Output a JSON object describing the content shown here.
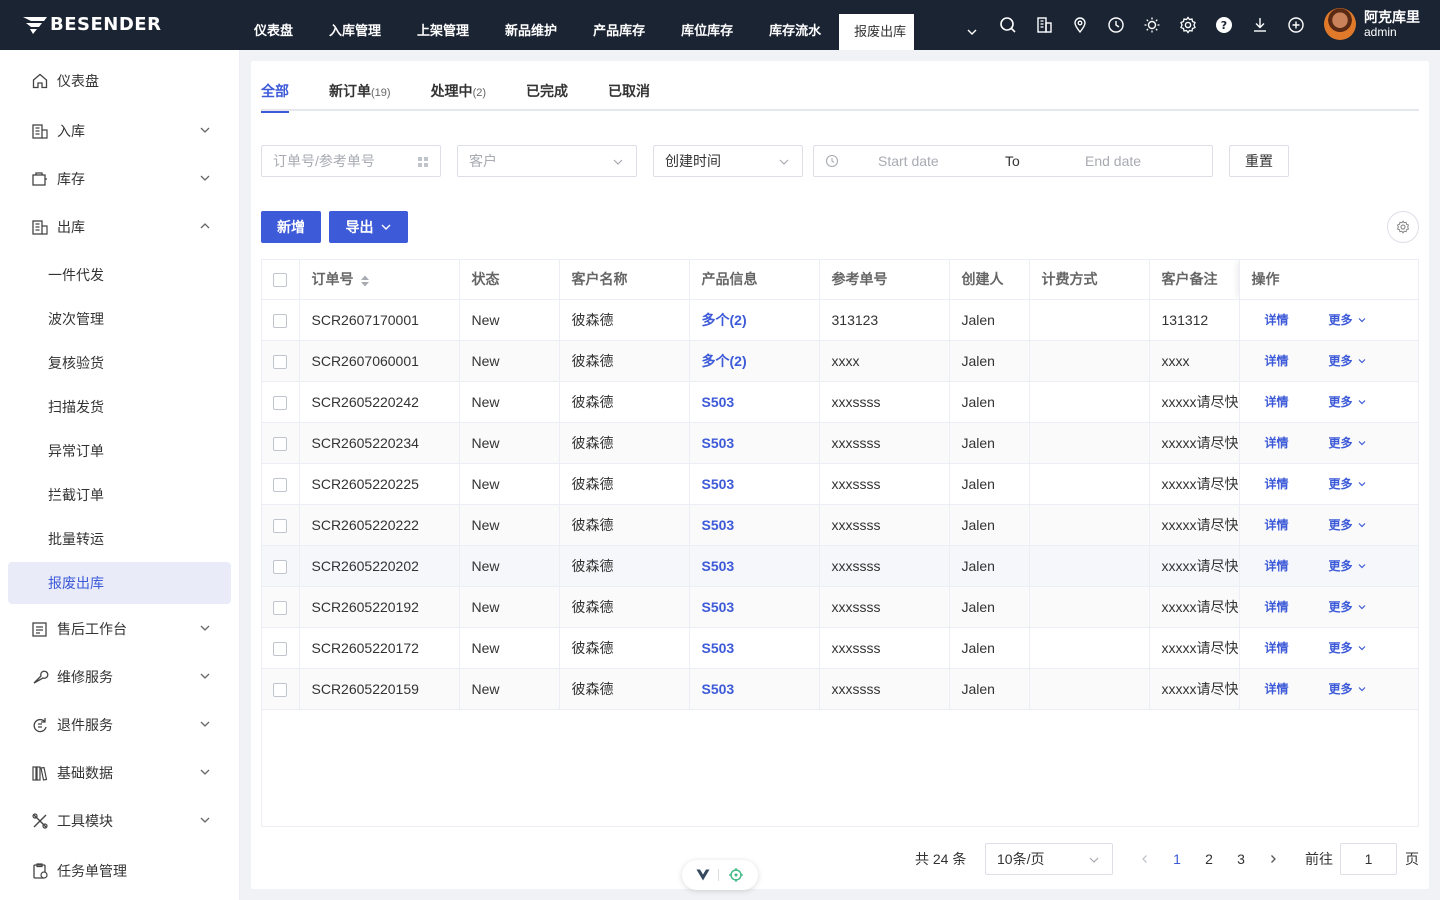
{
  "brand": {
    "name": "BESENDER"
  },
  "topnav": {
    "items": [
      "仪表盘",
      "入库管理",
      "上架管理",
      "新品维护",
      "产品库存",
      "库位库存",
      "库存流水"
    ],
    "active": "报废出库"
  },
  "top_icons": [
    "search-icon",
    "building-icon",
    "location-icon",
    "clock-icon",
    "sun-icon",
    "gear-icon",
    "help-icon",
    "download-icon",
    "add-circle-icon"
  ],
  "user": {
    "name": "阿克库里",
    "role": "admin"
  },
  "sidebar": {
    "items": [
      {
        "label": "仪表盘",
        "icon": "home-icon"
      },
      {
        "label": "入库",
        "icon": "inbound-icon"
      },
      {
        "label": "库存",
        "icon": "inventory-icon"
      },
      {
        "label": "出库",
        "icon": "outbound-icon"
      },
      {
        "label": "售后工作台",
        "icon": "aftersale-icon"
      },
      {
        "label": "维修服务",
        "icon": "wrench-icon"
      },
      {
        "label": "退件服务",
        "icon": "return-icon"
      },
      {
        "label": "基础数据",
        "icon": "data-icon"
      },
      {
        "label": "工具模块",
        "icon": "tools-icon"
      },
      {
        "label": "任务单管理",
        "icon": "task-icon"
      }
    ],
    "sub_items": [
      "一件代发",
      "波次管理",
      "复核验货",
      "扫描发货",
      "异常订单",
      "拦截订单",
      "批量转运",
      "报废出库"
    ],
    "active_sub": "报废出库"
  },
  "tabs": [
    {
      "label": "全部",
      "count": ""
    },
    {
      "label": "新订单",
      "count": "(19)"
    },
    {
      "label": "处理中",
      "count": "(2)"
    },
    {
      "label": "已完成",
      "count": ""
    },
    {
      "label": "已取消",
      "count": ""
    }
  ],
  "filters": {
    "order_placeholder": "订单号/参考单号",
    "customer_placeholder": "客户",
    "time_type": "创建时间",
    "start_placeholder": "Start date",
    "range_sep": "To",
    "end_placeholder": "End date",
    "reset_label": "重置"
  },
  "actions": {
    "add_label": "新增",
    "export_label": "导出"
  },
  "table": {
    "headers": [
      "订单号",
      "状态",
      "客户名称",
      "产品信息",
      "参考单号",
      "创建人",
      "计费方式",
      "客户备注",
      "操作"
    ],
    "rows": [
      {
        "order": "SCR2607170001",
        "status": "New",
        "customer": "彼森德",
        "product": "多个(2)",
        "ref": "313123",
        "creator": "Jalen",
        "billing": "",
        "remark": "131312"
      },
      {
        "order": "SCR2607060001",
        "status": "New",
        "customer": "彼森德",
        "product": "多个(2)",
        "ref": "xxxx",
        "creator": "Jalen",
        "billing": "",
        "remark": "xxxx"
      },
      {
        "order": "SCR2605220242",
        "status": "New",
        "customer": "彼森德",
        "product": "S503",
        "ref": "xxxssss",
        "creator": "Jalen",
        "billing": "",
        "remark": "xxxxx请尽快"
      },
      {
        "order": "SCR2605220234",
        "status": "New",
        "customer": "彼森德",
        "product": "S503",
        "ref": "xxxssss",
        "creator": "Jalen",
        "billing": "",
        "remark": "xxxxx请尽快"
      },
      {
        "order": "SCR2605220225",
        "status": "New",
        "customer": "彼森德",
        "product": "S503",
        "ref": "xxxssss",
        "creator": "Jalen",
        "billing": "",
        "remark": "xxxxx请尽快"
      },
      {
        "order": "SCR2605220222",
        "status": "New",
        "customer": "彼森德",
        "product": "S503",
        "ref": "xxxssss",
        "creator": "Jalen",
        "billing": "",
        "remark": "xxxxx请尽快"
      },
      {
        "order": "SCR2605220202",
        "status": "New",
        "customer": "彼森德",
        "product": "S503",
        "ref": "xxxssss",
        "creator": "Jalen",
        "billing": "",
        "remark": "xxxxx请尽快"
      },
      {
        "order": "SCR2605220192",
        "status": "New",
        "customer": "彼森德",
        "product": "S503",
        "ref": "xxxssss",
        "creator": "Jalen",
        "billing": "",
        "remark": "xxxxx请尽快"
      },
      {
        "order": "SCR2605220172",
        "status": "New",
        "customer": "彼森德",
        "product": "S503",
        "ref": "xxxssss",
        "creator": "Jalen",
        "billing": "",
        "remark": "xxxxx请尽快"
      },
      {
        "order": "SCR2605220159",
        "status": "New",
        "customer": "彼森德",
        "product": "S503",
        "ref": "xxxssss",
        "creator": "Jalen",
        "billing": "",
        "remark": "xxxxx请尽快"
      }
    ],
    "detail_label": "详情",
    "more_label": "更多"
  },
  "pagination": {
    "total_label": "共 24 条",
    "page_size": "10条/页",
    "pages": [
      "1",
      "2",
      "3"
    ],
    "current": "1",
    "goto_label": "前往",
    "goto_value": "1",
    "goto_suffix": "页"
  },
  "colors": {
    "primary": "#3d5ad8",
    "topbar": "#1b2433",
    "active_bg": "#e9ecf8"
  }
}
